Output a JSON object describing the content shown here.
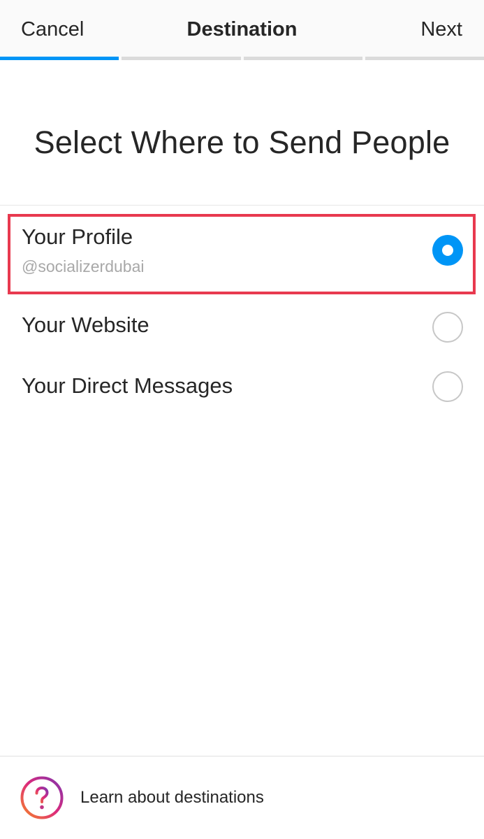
{
  "header": {
    "cancel_label": "Cancel",
    "title": "Destination",
    "next_label": "Next",
    "progress": {
      "current_step": 1,
      "total_steps": 4
    }
  },
  "heading": "Select Where to Send People",
  "options": [
    {
      "title": "Your Profile",
      "subtitle": "@socializerdubai",
      "selected": true
    },
    {
      "title": "Your Website",
      "selected": false
    },
    {
      "title": "Your Direct Messages",
      "selected": false
    }
  ],
  "footer": {
    "link_label": "Learn about destinations",
    "icon": "question-mark-icon"
  },
  "colors": {
    "accent": "#0095f6",
    "highlight": "#e8394f",
    "text": "#262626",
    "muted": "#a8a8a8",
    "icon_gradient": [
      "#f58529",
      "#dd2a7b",
      "#8134af"
    ]
  }
}
